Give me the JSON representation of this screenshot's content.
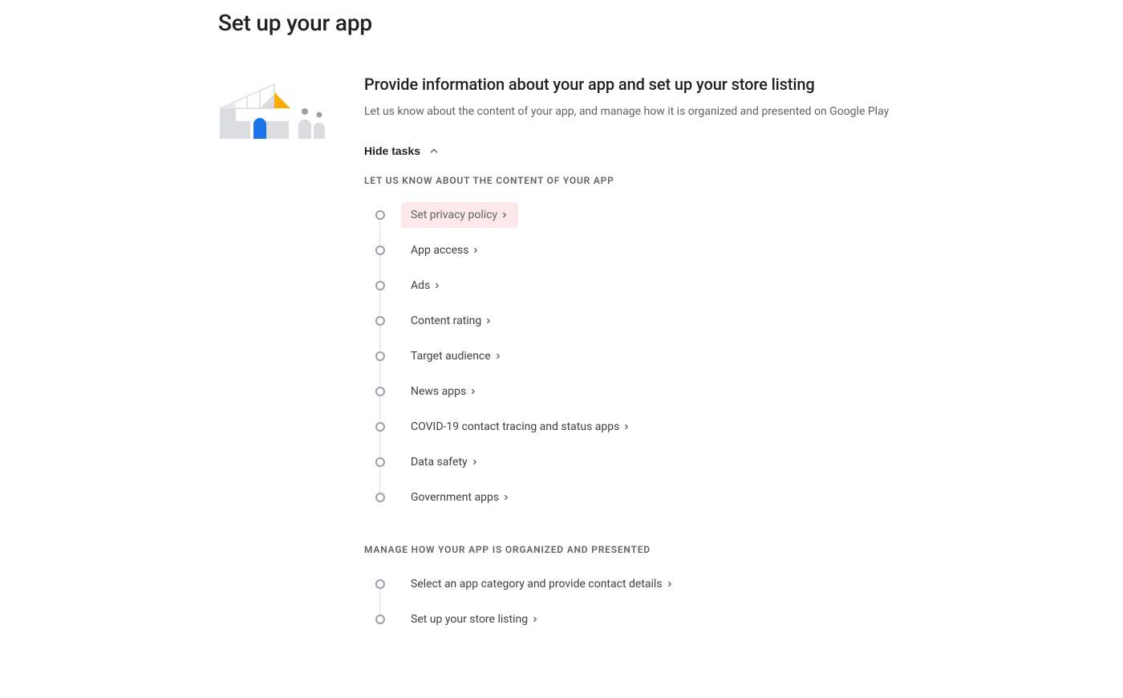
{
  "pageTitle": "Set up your app",
  "section": {
    "title": "Provide information about your app and set up your store listing",
    "desc": "Let us know about the content of your app, and manage how it is organized and presented on Google Play"
  },
  "hideTasksLabel": "Hide tasks",
  "group1": {
    "header": "LET US KNOW ABOUT THE CONTENT OF YOUR APP",
    "tasks": [
      "Set privacy policy",
      "App access",
      "Ads",
      "Content rating",
      "Target audience",
      "News apps",
      "COVID-19 contact tracing and status apps",
      "Data safety",
      "Government apps"
    ]
  },
  "group2": {
    "header": "MANAGE HOW YOUR APP IS ORGANIZED AND PRESENTED",
    "tasks": [
      "Select an app category and provide contact details",
      "Set up your store listing"
    ]
  }
}
